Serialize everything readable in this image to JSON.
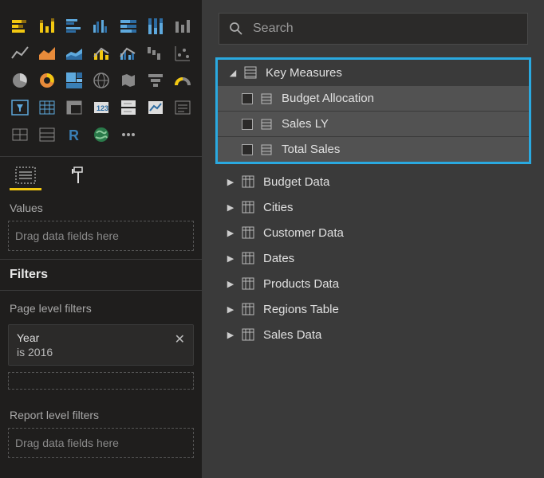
{
  "left": {
    "tabs": {
      "fields": "Fields",
      "format": "Format"
    },
    "values_label": "Values",
    "values_placeholder": "Drag data fields here",
    "filters_header": "Filters",
    "page_filters_label": "Page level filters",
    "filter": {
      "title": "Year",
      "sub": "is 2016",
      "close": "✕"
    },
    "report_filters_label": "Report level filters",
    "report_placeholder": "Drag data fields here"
  },
  "search": {
    "placeholder": "Search"
  },
  "fields": {
    "group": {
      "name": "Key Measures"
    },
    "measures": [
      {
        "name": "Budget Allocation"
      },
      {
        "name": "Sales LY"
      },
      {
        "name": "Total Sales"
      }
    ],
    "tables": [
      {
        "name": "Budget Data"
      },
      {
        "name": "Cities"
      },
      {
        "name": "Customer Data"
      },
      {
        "name": "Dates"
      },
      {
        "name": "Products Data"
      },
      {
        "name": "Regions Table"
      },
      {
        "name": "Sales Data"
      }
    ]
  }
}
